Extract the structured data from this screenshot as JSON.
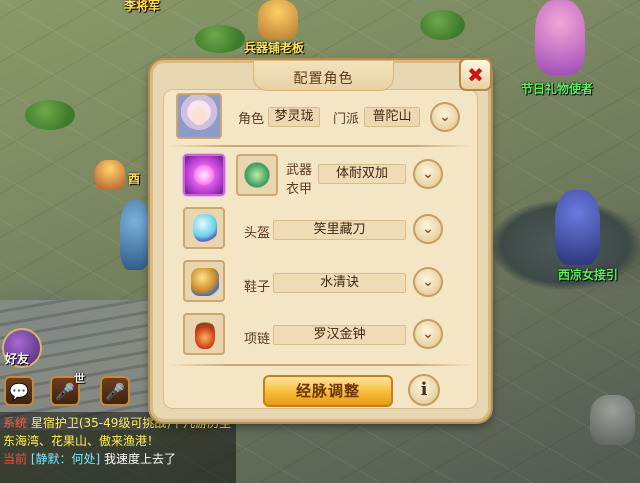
{
  "scene": {
    "npc_names": [
      {
        "id": "npc1",
        "text": "李将军",
        "color": "yellow"
      },
      {
        "id": "npc2",
        "text": "兵器铺老板",
        "color": "yellow"
      },
      {
        "id": "npc3",
        "text": "节日礼物使者",
        "color": "green"
      },
      {
        "id": "npc4",
        "text": "西凉女接引",
        "color": "green"
      },
      {
        "id": "npc5",
        "text": "酉",
        "color": "yellow"
      }
    ]
  },
  "dialog": {
    "title": "配置角色",
    "role_label": "角色",
    "role_value": "梦灵珑",
    "school_label": "门派",
    "school_value": "普陀山",
    "weapon_label": "武器",
    "armor_label": "衣甲",
    "weapon_armor_value": "体耐双加",
    "helmet_label": "头盔",
    "helmet_value": "笑里藏刀",
    "shoes_label": "鞋子",
    "shoes_value": "水清诀",
    "necklace_label": "项链",
    "necklace_value": "罗汉金钟",
    "main_button": "经脉调整",
    "info_button": "i",
    "close_icon": "✖"
  },
  "hud": {
    "friend_label": "好友",
    "chat_icon": "chat-bubble-icon",
    "voice_world_label": "世",
    "chat_lines": [
      {
        "tag": "系统",
        "text": "星宿护卫(35-49级可挑战)下凡游历至东海湾、花果山、傲来渔港！"
      },
      {
        "tag": "当前",
        "text": "[静默：何处]",
        "tail": "我速度上去了"
      }
    ]
  }
}
